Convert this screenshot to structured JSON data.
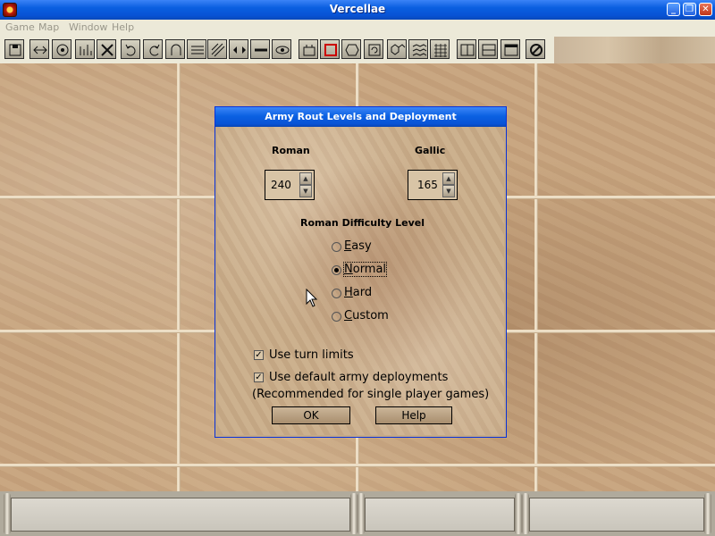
{
  "window": {
    "title": "Vercellae",
    "min_label": "_",
    "restore_label": "❐",
    "close_label": "✕"
  },
  "menu": [
    "Game",
    "Map",
    "Window",
    "Help"
  ],
  "toolbar": {
    "icons": [
      "save-icon",
      "move-icon",
      "disk-icon",
      "chart-icon",
      "crossed-swords-icon",
      "undo-icon",
      "redo-icon",
      "loop-icon",
      "hex-lines-icon",
      "diagonal-lines-icon",
      "arrows-icon",
      "bar-icon",
      "eye-icon",
      "unit-icon",
      "range-icon",
      "hexagon-icon",
      "rotate-icon",
      "hex-group-icon",
      "hex-grid-icon",
      "hex-mesh-icon",
      "window-panes-icon",
      "horizontal-panes-icon",
      "frame-icon",
      "no-entry-icon"
    ]
  },
  "dialog": {
    "title": "Army Rout Levels and Deployment",
    "roman_label": "Roman",
    "gallic_label": "Gallic",
    "roman_value": "240",
    "gallic_value": "165",
    "difficulty_label": "Roman Difficulty Level",
    "difficulty_options": [
      "Easy",
      "Normal",
      "Hard",
      "Custom"
    ],
    "difficulty_selected": "Normal",
    "use_turn_limits": {
      "label": "Use turn limits",
      "checked": true
    },
    "use_default_deployments": {
      "label": "Use default army deployments",
      "checked": true
    },
    "recommendation": "(Recommended for single player games)",
    "ok_label": "OK",
    "help_label": "Help"
  },
  "colors": {
    "title_blue": "#0a5fe0",
    "parchment": "#c9ad8a",
    "menu_disabled": "#9a978a"
  }
}
